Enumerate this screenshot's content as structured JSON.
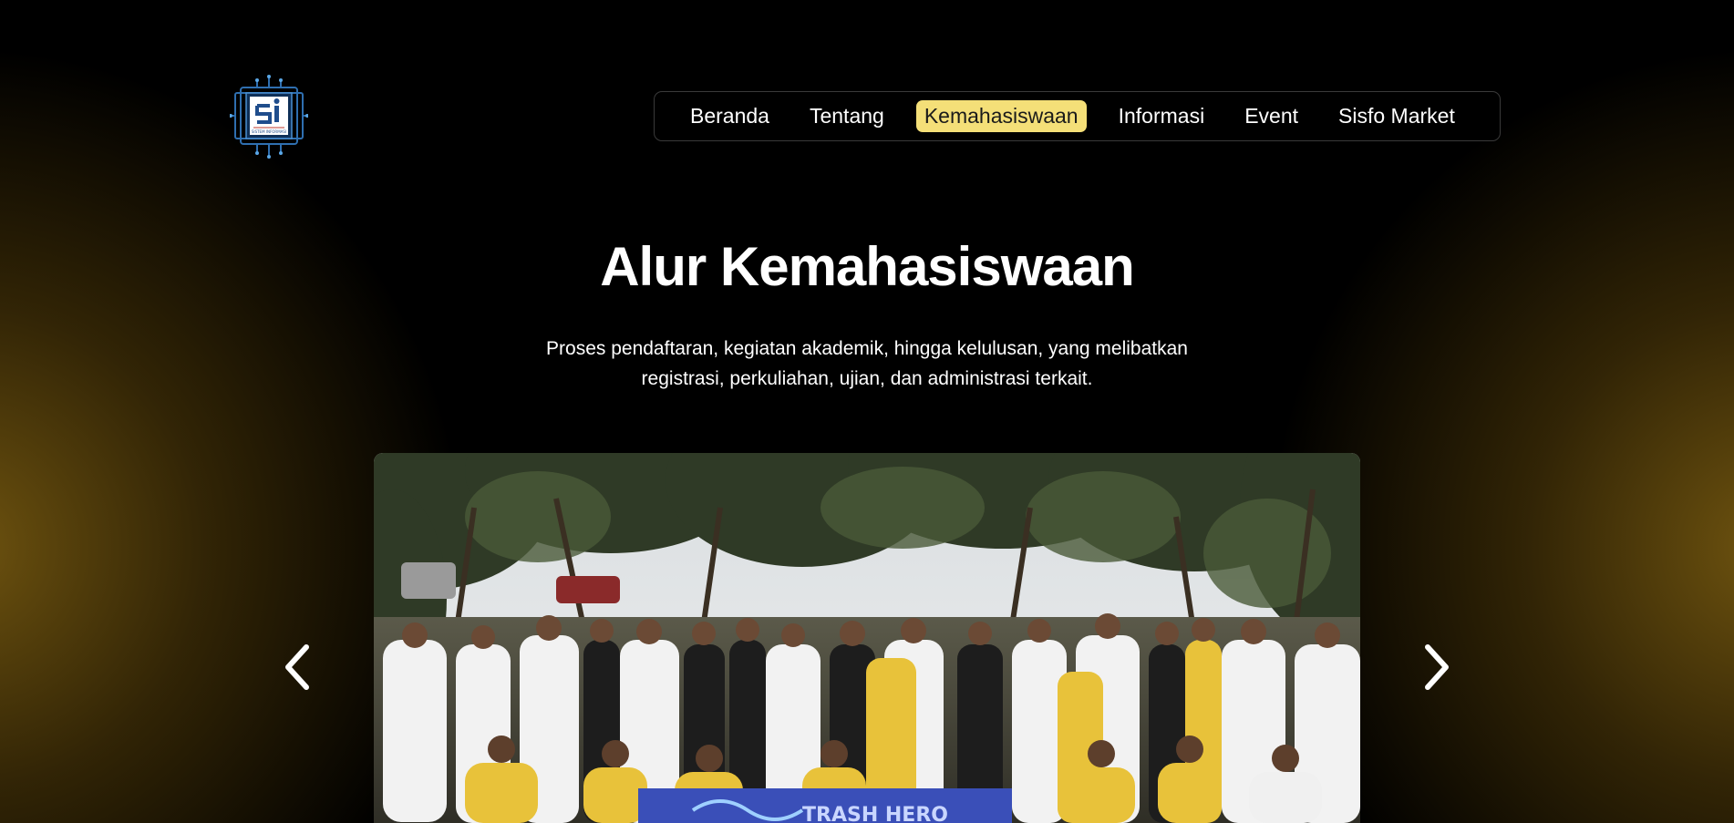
{
  "logo": {
    "letters": "SI",
    "caption": "SISTEM INFORMASI"
  },
  "nav": {
    "items": [
      {
        "label": "Beranda",
        "active": false
      },
      {
        "label": "Tentang",
        "active": false
      },
      {
        "label": "Kemahasiswaan",
        "active": true
      },
      {
        "label": "Informasi",
        "active": false
      },
      {
        "label": "Event",
        "active": false
      },
      {
        "label": "Sisfo Market",
        "active": false
      }
    ]
  },
  "hero": {
    "title": "Alur Kemahasiswaan",
    "subtitle_line1": "Proses pendaftaran, kegiatan akademik, hingga kelulusan, yang melibatkan",
    "subtitle_line2": "registrasi, perkuliahan, ujian, dan administrasi terkait."
  },
  "carousel": {
    "prev_icon": "chevron-left-icon",
    "next_icon": "chevron-right-icon",
    "banner_text": "TRASH HERO"
  },
  "colors": {
    "accent": "#f4df78",
    "background": "#000000",
    "glow": "#826212"
  }
}
